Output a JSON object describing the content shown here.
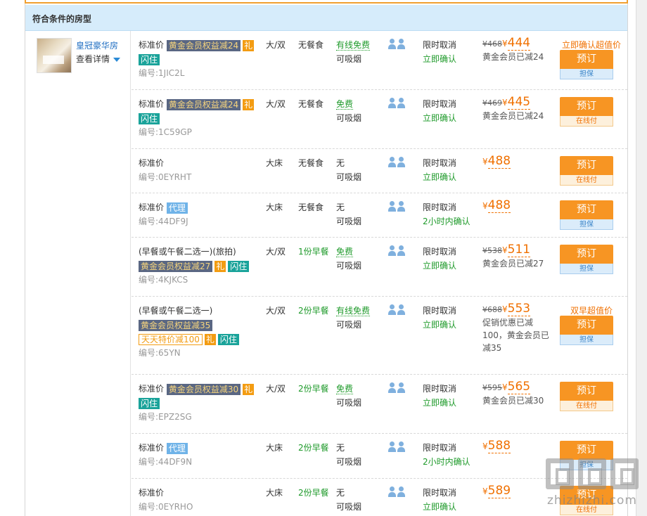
{
  "section": {
    "title": "符合条件的房型"
  },
  "room": {
    "name": "皇冠豪华房",
    "detail_label": "查看详情"
  },
  "rows": [
    {
      "name_prefix": "标准价",
      "gold_tag": "黄金会员权益减24",
      "gift": "礼",
      "flash": "闪住",
      "code": "编号:1JIC2L",
      "bed": "大/双",
      "meal": "无餐食",
      "net": "有线免费",
      "smoke": "可吸烟",
      "cancel": "限时取消",
      "confirm": "立即确认",
      "orig_price": "¥468",
      "yen": "¥",
      "price": "444",
      "note": "黄金会员已减24",
      "promo": "立即确认超值价",
      "book": "预订",
      "sub": "担保"
    },
    {
      "name_prefix": "标准价",
      "gold_tag": "黄金会员权益减24",
      "gift": "礼",
      "flash": "闪住",
      "code": "编号:1C59GP",
      "bed": "大/双",
      "meal": "无餐食",
      "net": "免费",
      "smoke": "可吸烟",
      "cancel": "限时取消",
      "confirm": "立即确认",
      "orig_price": "¥469",
      "yen": "¥",
      "price": "445",
      "note": "黄金会员已减24",
      "book": "预订",
      "sub": "在线付"
    },
    {
      "name_prefix": "标准价",
      "code": "编号:0EYRHT",
      "bed": "大床",
      "meal": "无餐食",
      "net": "无",
      "smoke": "可吸烟",
      "cancel": "限时取消",
      "confirm": "立即确认",
      "yen": "¥",
      "price": "488",
      "book": "预订",
      "sub": "在线付"
    },
    {
      "name_prefix": "标准价",
      "agent": "代理",
      "code": "编号:44DF9J",
      "bed": "大床",
      "meal": "无餐食",
      "net": "无",
      "smoke": "可吸烟",
      "cancel": "限时取消",
      "confirm": "2小时内确认",
      "yen": "¥",
      "price": "488",
      "book": "预订",
      "sub": "担保"
    },
    {
      "name_prefix": "(早餐或午餐二选一)(旅拍)",
      "gold_tag": "黄金会员权益减27",
      "gift": "礼",
      "flash": "闪住",
      "code": "编号:4KJKCS",
      "bed": "大/双",
      "meal": "1份早餐",
      "net": "免费",
      "smoke": "可吸烟",
      "cancel": "限时取消",
      "confirm": "立即确认",
      "orig_price": "¥538",
      "yen": "¥",
      "price": "511",
      "note": "黄金会员已减27",
      "book": "预订",
      "sub": "担保"
    },
    {
      "name_prefix": "(早餐或午餐二选一)",
      "gold_tag": "黄金会员权益减35",
      "daily": "天天特价减100",
      "gift": "礼",
      "flash": "闪住",
      "code": "编号:65YN",
      "bed": "大/双",
      "meal": "2份早餐",
      "net": "有线免费",
      "smoke": "可吸烟",
      "cancel": "限时取消",
      "confirm": "立即确认",
      "orig_price": "¥688",
      "yen": "¥",
      "price": "553",
      "note": "促销优惠已减100，黄金会员已减35",
      "promo": "双早超值价",
      "book": "预订",
      "sub": "担保"
    },
    {
      "name_prefix": "标准价",
      "gold_tag": "黄金会员权益减30",
      "gift": "礼",
      "flash": "闪住",
      "code": "编号:EPZ2SG",
      "bed": "大/双",
      "meal": "2份早餐",
      "net": "免费",
      "smoke": "可吸烟",
      "cancel": "限时取消",
      "confirm": "立即确认",
      "orig_price": "¥595",
      "yen": "¥",
      "price": "565",
      "note": "黄金会员已减30",
      "book": "预订",
      "sub": "在线付"
    },
    {
      "name_prefix": "标准价",
      "agent": "代理",
      "code": "编号:44DF9N",
      "bed": "大床",
      "meal": "2份早餐",
      "net": "无",
      "smoke": "可吸烟",
      "cancel": "限时取消",
      "confirm": "2小时内确认",
      "yen": "¥",
      "price": "588",
      "book": "预订",
      "sub": "担保"
    },
    {
      "name_prefix": "标准价",
      "code": "编号:0EYRHO",
      "bed": "大床",
      "meal": "2份早餐",
      "net": "无",
      "smoke": "可吸烟",
      "cancel": "限时取消",
      "confirm": "立即确认",
      "yen": "¥",
      "price": "589",
      "book": "预订",
      "sub": "在线付"
    }
  ],
  "watermark": {
    "text": "zhizhizhi.com"
  }
}
